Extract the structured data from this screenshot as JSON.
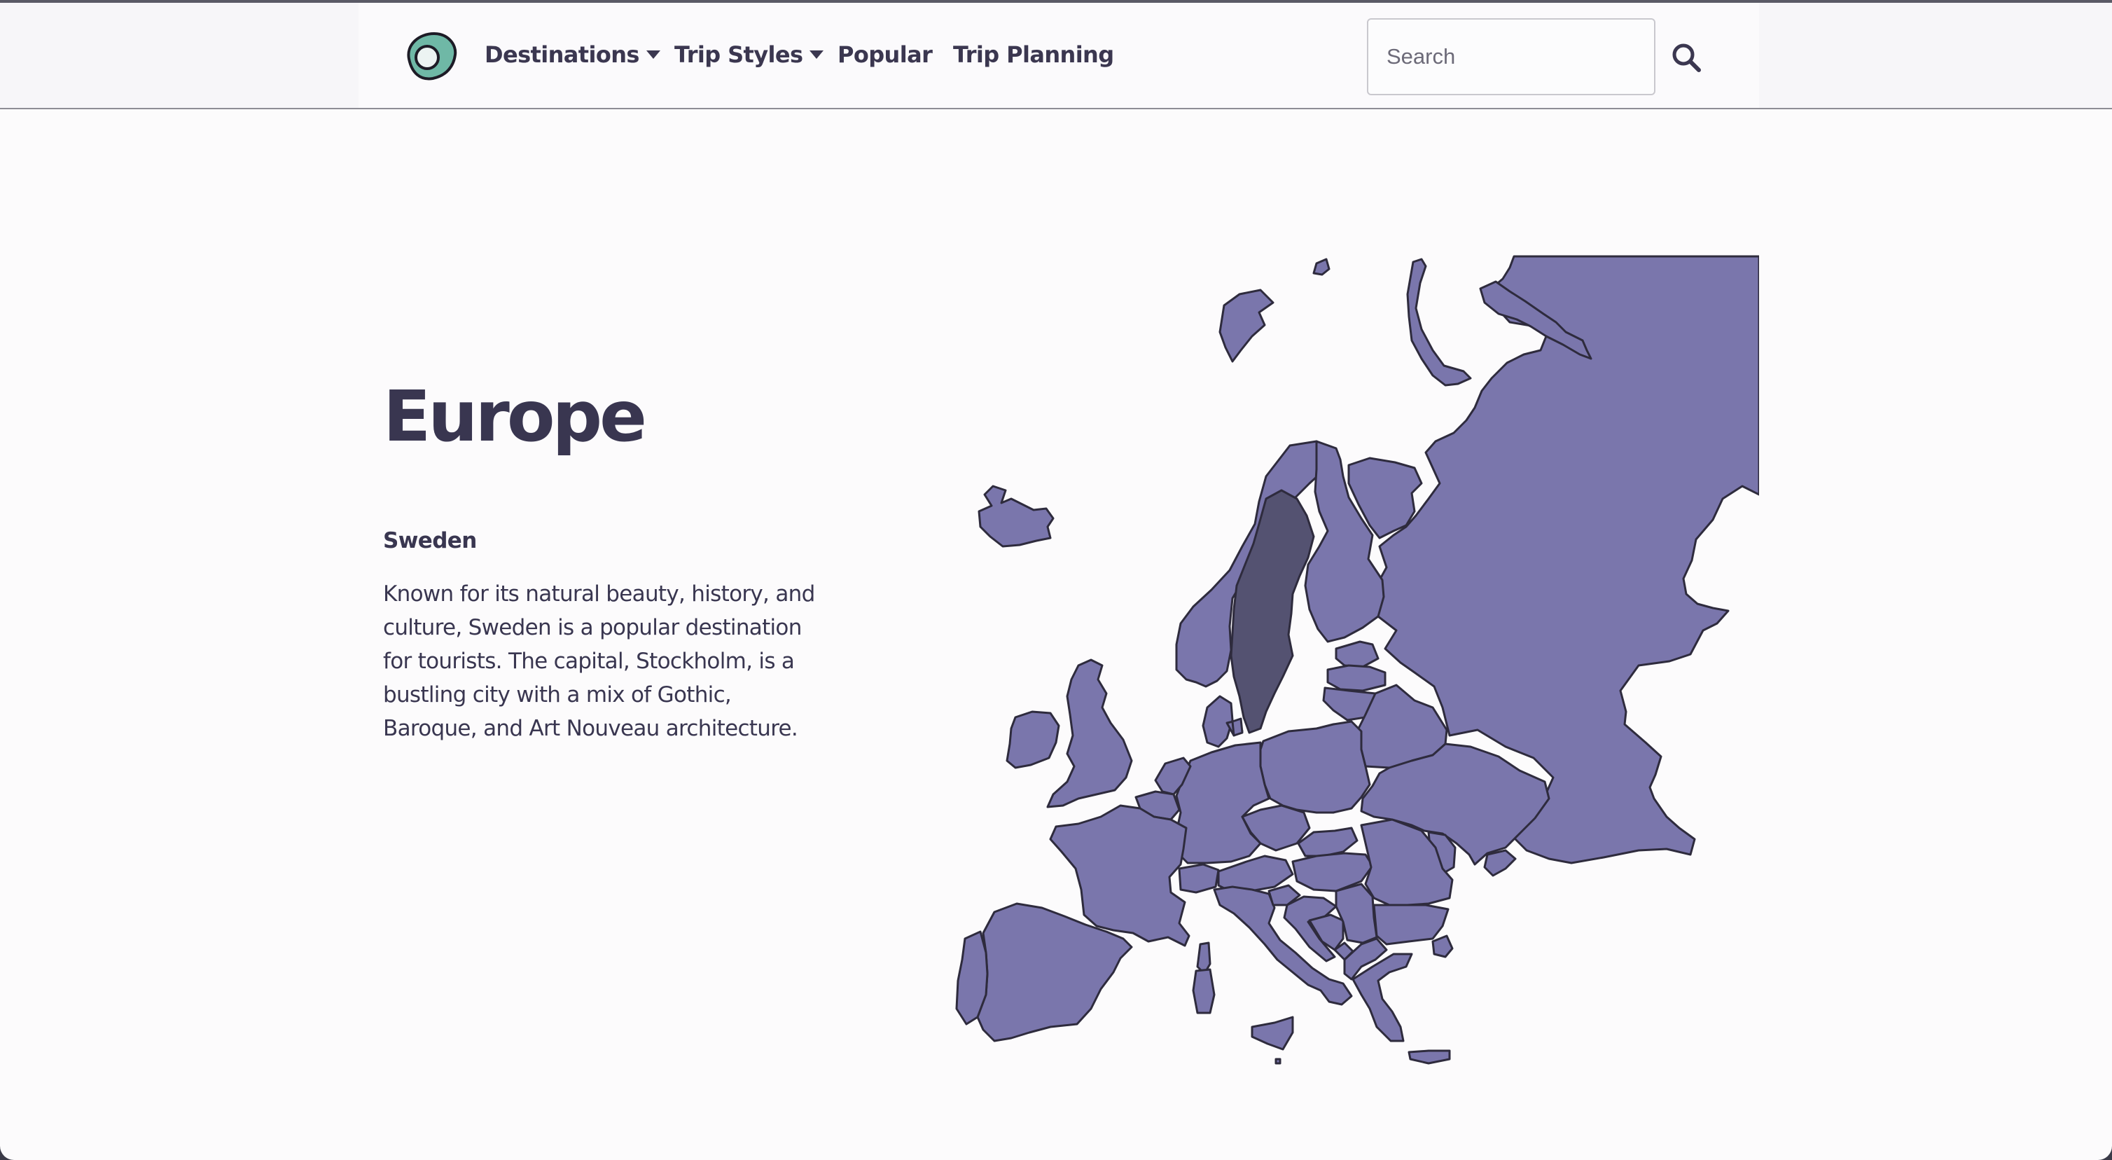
{
  "nav": {
    "links": [
      {
        "label": "Destinations",
        "dropdown": true
      },
      {
        "label": "Trip Styles",
        "dropdown": true
      },
      {
        "label": "Popular",
        "dropdown": false
      },
      {
        "label": "Trip Planning",
        "dropdown": false
      }
    ],
    "search": {
      "placeholder": "Search"
    },
    "logo_icon": "eye-logo-icon",
    "search_icon": "search-icon"
  },
  "hero": {
    "title": "Europe",
    "country": "Sweden",
    "description": "Known for its natural beauty, history, and culture, Sweden is a popular destination for tourists. The capital, Stockholm, is a bustling city with a mix of Gothic, Baroque, and Art Nouveau architecture."
  },
  "map": {
    "highlighted_country": "Sweden",
    "colors": {
      "land": "#7a76ac",
      "highlight": "#545271",
      "border": "#2e2b3d",
      "logo_teal": "#6fb8a6"
    }
  }
}
